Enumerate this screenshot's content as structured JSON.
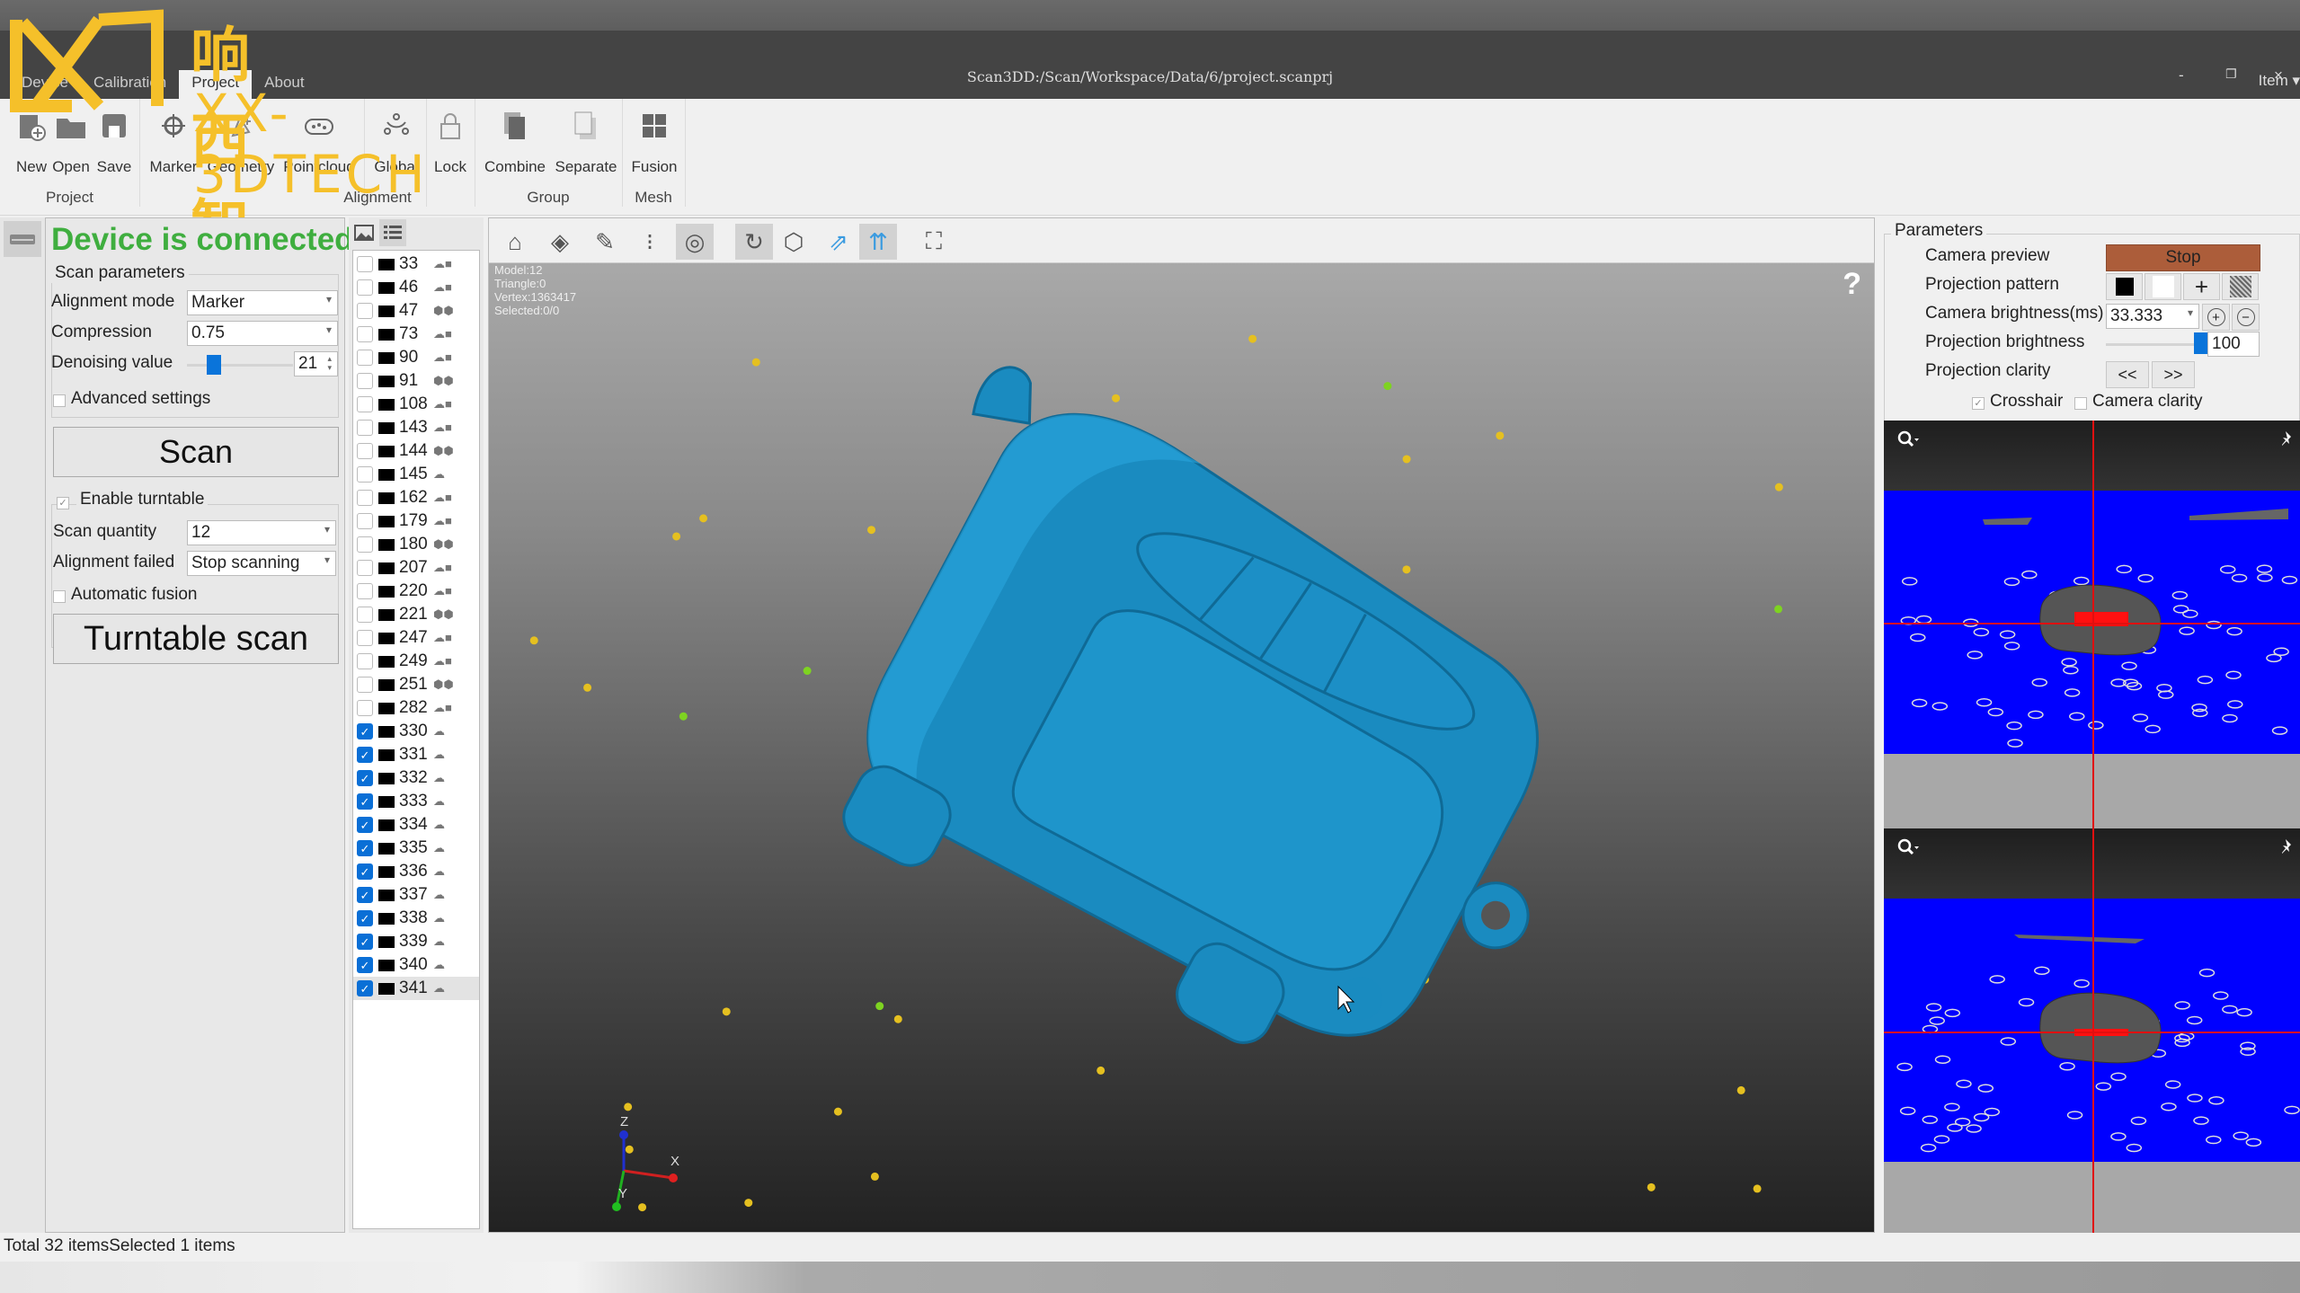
{
  "window": {
    "title": "Scan3DD:/Scan/Workspace/Data/6/project.scanprj",
    "minimize": "-",
    "restore": "❐",
    "close": "×",
    "item_menu": "Item ▾"
  },
  "watermark": {
    "brand_cn": "响西智能",
    "brand_en": "XX-3DTECH"
  },
  "tabs": [
    {
      "label": "Device"
    },
    {
      "label": "Calibration"
    },
    {
      "label": "Project",
      "active": true
    },
    {
      "label": "About"
    }
  ],
  "ribbon": {
    "buttons": [
      {
        "label": "New",
        "icon": "new-file-icon"
      },
      {
        "label": "Open",
        "icon": "open-folder-icon"
      },
      {
        "label": "Save",
        "icon": "save-icon"
      },
      {
        "label": "Marker",
        "icon": "marker-target-icon"
      },
      {
        "label": "Geometry",
        "icon": "geometry-icon"
      },
      {
        "label": "Pointcloud",
        "icon": "pointcloud-icon"
      },
      {
        "label": "Global",
        "icon": "global-align-icon"
      },
      {
        "label": "Lock",
        "icon": "lock-icon"
      },
      {
        "label": "Combine",
        "icon": "combine-icon"
      },
      {
        "label": "Separate",
        "icon": "separate-icon"
      },
      {
        "label": "Fusion",
        "icon": "fusion-grid-icon"
      }
    ],
    "groups": [
      "Project",
      "Alignment",
      "Group",
      "Mesh"
    ]
  },
  "left_panel": {
    "device_status": "Device is connected",
    "scan_parameters_title": "Scan parameters",
    "alignment_mode_label": "Alignment mode",
    "alignment_mode_value": "Marker",
    "compression_label": "Compression",
    "compression_value": "0.75",
    "denoising_label": "Denoising value",
    "denoising_value": "21",
    "denoising_slider_fraction": 0.22,
    "advanced_settings_label": "Advanced settings",
    "advanced_settings_checked": false,
    "scan_button": "Scan",
    "enable_turntable_label": "Enable turntable",
    "enable_turntable_checked": true,
    "scan_quantity_label": "Scan quantity",
    "scan_quantity_value": "12",
    "alignment_failed_label": "Alignment failed",
    "alignment_failed_value": "Stop scanning",
    "automatic_fusion_label": "Automatic fusion",
    "automatic_fusion_checked": false,
    "turntable_scan_button": "Turntable scan"
  },
  "scan_list": {
    "items": [
      {
        "id": "33",
        "checked": false,
        "type": "pointcloud-mesh"
      },
      {
        "id": "46",
        "checked": false,
        "type": "pointcloud-mesh"
      },
      {
        "id": "47",
        "checked": false,
        "type": "model"
      },
      {
        "id": "73",
        "checked": false,
        "type": "pointcloud-mesh"
      },
      {
        "id": "90",
        "checked": false,
        "type": "pointcloud-mesh"
      },
      {
        "id": "91",
        "checked": false,
        "type": "model"
      },
      {
        "id": "108",
        "checked": false,
        "type": "pointcloud-mesh"
      },
      {
        "id": "143",
        "checked": false,
        "type": "pointcloud-mesh"
      },
      {
        "id": "144",
        "checked": false,
        "type": "model"
      },
      {
        "id": "145",
        "checked": false,
        "type": "pointcloud"
      },
      {
        "id": "162",
        "checked": false,
        "type": "pointcloud-mesh"
      },
      {
        "id": "179",
        "checked": false,
        "type": "pointcloud-mesh"
      },
      {
        "id": "180",
        "checked": false,
        "type": "model"
      },
      {
        "id": "207",
        "checked": false,
        "type": "pointcloud-mesh"
      },
      {
        "id": "220",
        "checked": false,
        "type": "pointcloud-mesh"
      },
      {
        "id": "221",
        "checked": false,
        "type": "model"
      },
      {
        "id": "247",
        "checked": false,
        "type": "pointcloud-mesh"
      },
      {
        "id": "249",
        "checked": false,
        "type": "pointcloud-mesh"
      },
      {
        "id": "251",
        "checked": false,
        "type": "model"
      },
      {
        "id": "282",
        "checked": false,
        "type": "pointcloud-mesh"
      },
      {
        "id": "330",
        "checked": true,
        "type": "pointcloud"
      },
      {
        "id": "331",
        "checked": true,
        "type": "pointcloud"
      },
      {
        "id": "332",
        "checked": true,
        "type": "pointcloud"
      },
      {
        "id": "333",
        "checked": true,
        "type": "pointcloud"
      },
      {
        "id": "334",
        "checked": true,
        "type": "pointcloud"
      },
      {
        "id": "335",
        "checked": true,
        "type": "pointcloud"
      },
      {
        "id": "336",
        "checked": true,
        "type": "pointcloud"
      },
      {
        "id": "337",
        "checked": true,
        "type": "pointcloud"
      },
      {
        "id": "338",
        "checked": true,
        "type": "pointcloud"
      },
      {
        "id": "339",
        "checked": true,
        "type": "pointcloud"
      },
      {
        "id": "340",
        "checked": true,
        "type": "pointcloud"
      },
      {
        "id": "341",
        "checked": true,
        "type": "pointcloud",
        "selected": true
      }
    ]
  },
  "viewport": {
    "tools": [
      {
        "name": "home-view",
        "active": false
      },
      {
        "name": "mesh-grid",
        "active": false
      },
      {
        "name": "measure-tools",
        "active": false
      },
      {
        "name": "point-filter",
        "active": false
      },
      {
        "name": "circle-select",
        "active": true
      },
      {
        "name": "rotate-select",
        "active": true
      },
      {
        "name": "polygon-select",
        "active": false
      },
      {
        "name": "plane-through",
        "active": false
      },
      {
        "name": "plane-through-all",
        "active": true
      },
      {
        "name": "fit-view",
        "active": false
      }
    ],
    "stats": {
      "model": "Model:12",
      "triangle": "Triangle:0",
      "vertex": "Vertex:1363417",
      "selected": "Selected:0/0"
    },
    "help": "?",
    "axes": {
      "x": "X",
      "y": "Y",
      "z": "Z"
    },
    "model_color": "#1a8bc0",
    "marker_color": "#e5c020"
  },
  "right_panel": {
    "parameters_title": "Parameters",
    "camera_preview_label": "Camera preview",
    "camera_preview_button": "Stop",
    "projection_pattern_label": "Projection pattern",
    "camera_brightness_label": "Camera brightness(ms)",
    "camera_brightness_value": "33.333",
    "projection_brightness_label": "Projection brightness",
    "projection_brightness_value": "100",
    "projection_brightness_fraction": 1.0,
    "projection_clarity_label": "Projection clarity",
    "clarity_prev": "<<",
    "clarity_next": ">>",
    "crosshair_label": "Crosshair",
    "crosshair_checked": true,
    "camera_clarity_label": "Camera clarity",
    "camera_clarity_checked": false
  },
  "status_bar": {
    "text": "Total 32 itemsSelected 1 items"
  }
}
